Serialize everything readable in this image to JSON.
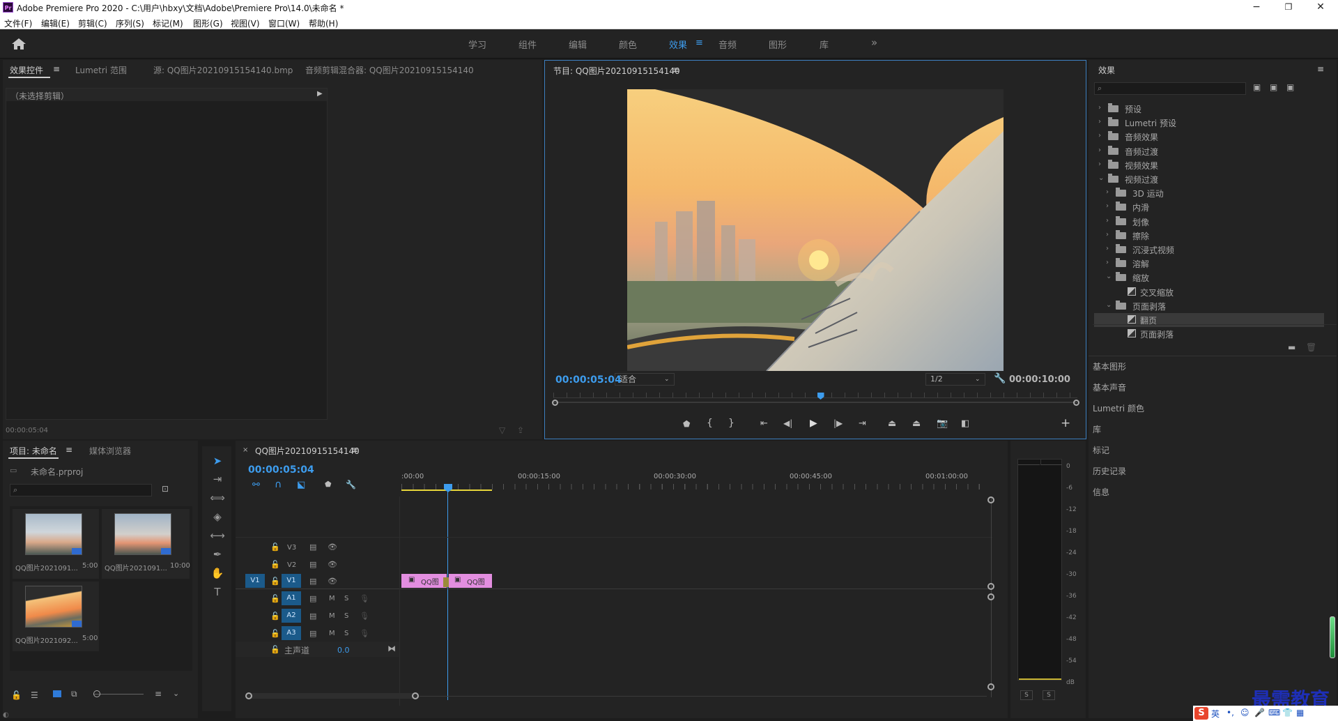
{
  "app": {
    "title": "Adobe Premiere Pro 2020 - C:\\用户\\hbxy\\文档\\Adobe\\Premiere Pro\\14.0\\未命名 *",
    "logo": "Pr",
    "window_buttons": {
      "minimize": "−",
      "maximize": "❐",
      "close": "✕"
    }
  },
  "menu": [
    "文件(F)",
    "编辑(E)",
    "剪辑(C)",
    "序列(S)",
    "标记(M)",
    "图形(G)",
    "视图(V)",
    "窗口(W)",
    "帮助(H)"
  ],
  "workspaces": {
    "items": [
      "学习",
      "组件",
      "编辑",
      "颜色",
      "效果",
      "音频",
      "图形",
      "库"
    ],
    "active": "效果",
    "more": "»"
  },
  "source_panel": {
    "tabs": [
      "效果控件",
      "Lumetri 范围",
      "源: QQ图片20210915154140.bmp",
      "音频剪辑混合器: QQ图片20210915154140"
    ],
    "no_clip": "（未选择剪辑）",
    "timecode": "00:00:05:04"
  },
  "program_monitor": {
    "title": "节目: QQ图片20210915154140",
    "current_time": "00:00:05:04",
    "fit": "适合",
    "resolution": "1/2",
    "duration": "00:00:10:00",
    "playhead_fraction": 0.51
  },
  "effects_panel": {
    "title": "效果",
    "items": [
      {
        "label": "预设",
        "depth": 0,
        "type": "folder",
        "expanded": false
      },
      {
        "label": "Lumetri 预设",
        "depth": 0,
        "type": "folder",
        "expanded": false
      },
      {
        "label": "音频效果",
        "depth": 0,
        "type": "folder",
        "expanded": false
      },
      {
        "label": "音频过渡",
        "depth": 0,
        "type": "folder",
        "expanded": false
      },
      {
        "label": "视频效果",
        "depth": 0,
        "type": "folder",
        "expanded": false
      },
      {
        "label": "视频过渡",
        "depth": 0,
        "type": "folder",
        "expanded": true
      },
      {
        "label": "3D 运动",
        "depth": 1,
        "type": "folder",
        "expanded": false
      },
      {
        "label": "内滑",
        "depth": 1,
        "type": "folder",
        "expanded": false
      },
      {
        "label": "划像",
        "depth": 1,
        "type": "folder",
        "expanded": false
      },
      {
        "label": "擦除",
        "depth": 1,
        "type": "folder",
        "expanded": false
      },
      {
        "label": "沉浸式视频",
        "depth": 1,
        "type": "folder",
        "expanded": false
      },
      {
        "label": "溶解",
        "depth": 1,
        "type": "folder",
        "expanded": false
      },
      {
        "label": "缩放",
        "depth": 1,
        "type": "folder",
        "expanded": true
      },
      {
        "label": "交叉缩放",
        "depth": 2,
        "type": "effect"
      },
      {
        "label": "页面剥落",
        "depth": 1,
        "type": "folder",
        "expanded": true
      },
      {
        "label": "翻页",
        "depth": 2,
        "type": "effect",
        "selected": true
      },
      {
        "label": "页面剥落",
        "depth": 2,
        "type": "effect"
      }
    ],
    "sections": [
      "基本图形",
      "基本声音",
      "Lumetri 颜色",
      "库",
      "标记",
      "历史记录",
      "信息"
    ]
  },
  "project_panel": {
    "tabs": [
      "项目: 未命名",
      "媒体浏览器"
    ],
    "project_file": "未命名.prproj",
    "items": [
      {
        "name": "QQ图片2021091...",
        "duration": "5:00"
      },
      {
        "name": "QQ图片2021091...",
        "duration": "10:00"
      },
      {
        "name": "QQ图片2021092...",
        "duration": "5:00"
      }
    ]
  },
  "timeline": {
    "sequence_name": "QQ图片20210915154140",
    "timecode": "00:00:05:04",
    "ruler": [
      ":00:00",
      "00:00:15:00",
      "00:00:30:00",
      "00:00:45:00",
      "00:01:00:00"
    ],
    "video_tracks": [
      "V3",
      "V2",
      "V1"
    ],
    "audio_tracks": [
      "A1",
      "A2",
      "A3"
    ],
    "source_patch": "V1",
    "master": {
      "label": "主声道",
      "value": "0.0"
    },
    "clips": [
      "QQ图",
      "QQ图"
    ],
    "mute": "M",
    "solo": "S"
  },
  "audio_meter": {
    "ticks": [
      "0",
      "-6",
      "-12",
      "-18",
      "-24",
      "-30",
      "-36",
      "-42",
      "-48",
      "-54",
      "dB"
    ],
    "solo_left": "S",
    "solo_right": "S"
  },
  "watermark": "最需教育",
  "taskbar": {
    "ime": "英"
  },
  "colors": {
    "accent": "#3d9ced",
    "clip": "#e38ee0",
    "track_target": "#1b5a8a",
    "background": "#1d1d1d"
  }
}
